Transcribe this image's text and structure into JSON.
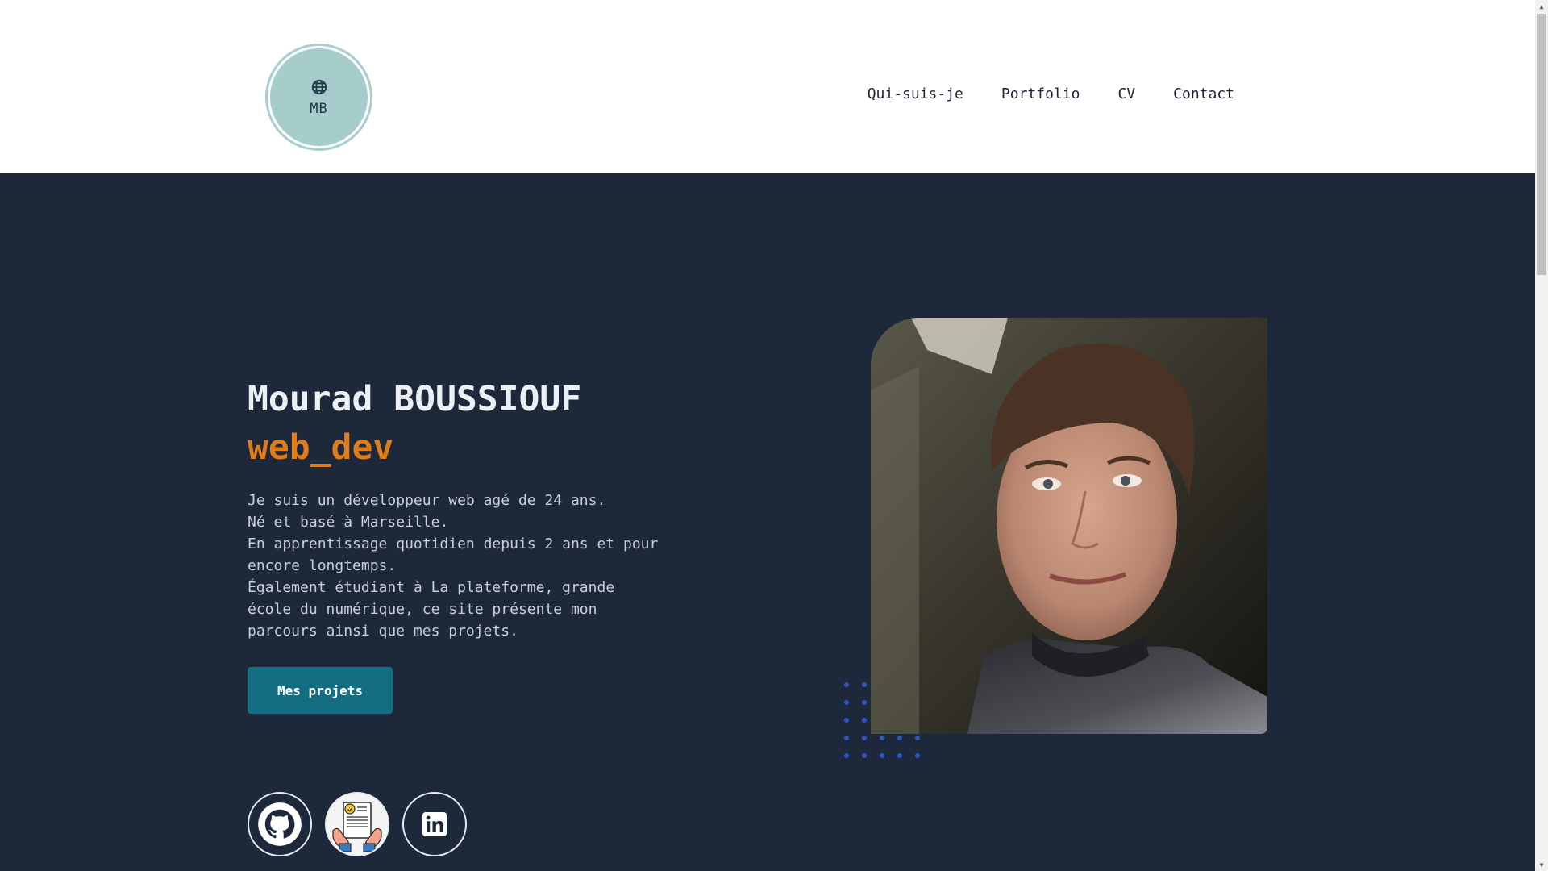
{
  "header": {
    "logo_text": "MB",
    "nav": [
      {
        "label": "Qui-suis-je"
      },
      {
        "label": "Portfolio"
      },
      {
        "label": "CV"
      },
      {
        "label": "Contact"
      }
    ]
  },
  "hero": {
    "name": "Mourad BOUSSIOUF",
    "role": "web_dev",
    "description": [
      "Je suis un développeur web agé de 24 ans.",
      "Né et basé à Marseille.",
      "En apprentissage quotidien depuis 2 ans et pour",
      "encore longtemps.",
      "Également étudiant à La plateforme, grande",
      "école du numérique, ce site présente mon",
      "parcours ainsi que mes projets."
    ],
    "cta_label": "Mes projets"
  },
  "socials": [
    {
      "icon": "github-icon"
    },
    {
      "icon": "cv-document-icon"
    },
    {
      "icon": "linkedin-icon"
    }
  ],
  "colors": {
    "background": "#1e283b",
    "header_bg": "#ffffff",
    "accent_orange": "#dd7d1b",
    "cta_bg": "#136e82",
    "logo_bg": "#a6cccc",
    "dots": "#2f55c7"
  }
}
